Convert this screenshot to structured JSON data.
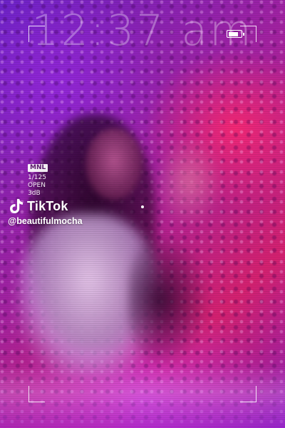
{
  "overlay": {
    "clock_text": "12:37 am",
    "battery_level": 0.85
  },
  "camera_info": {
    "location_badge": "MNL",
    "shutter_speed": "1/125",
    "aperture": "OPEN",
    "gain": "3dB"
  },
  "watermark": {
    "brand": "TikTok",
    "username": "@beautifulmocha"
  },
  "colors": {
    "accent_pink": "#d42170",
    "accent_purple": "#8d1fb5",
    "hud_white": "#ffffff"
  },
  "icons": [
    "battery-icon",
    "tiktok-logo-icon",
    "focus-frame-icon"
  ]
}
